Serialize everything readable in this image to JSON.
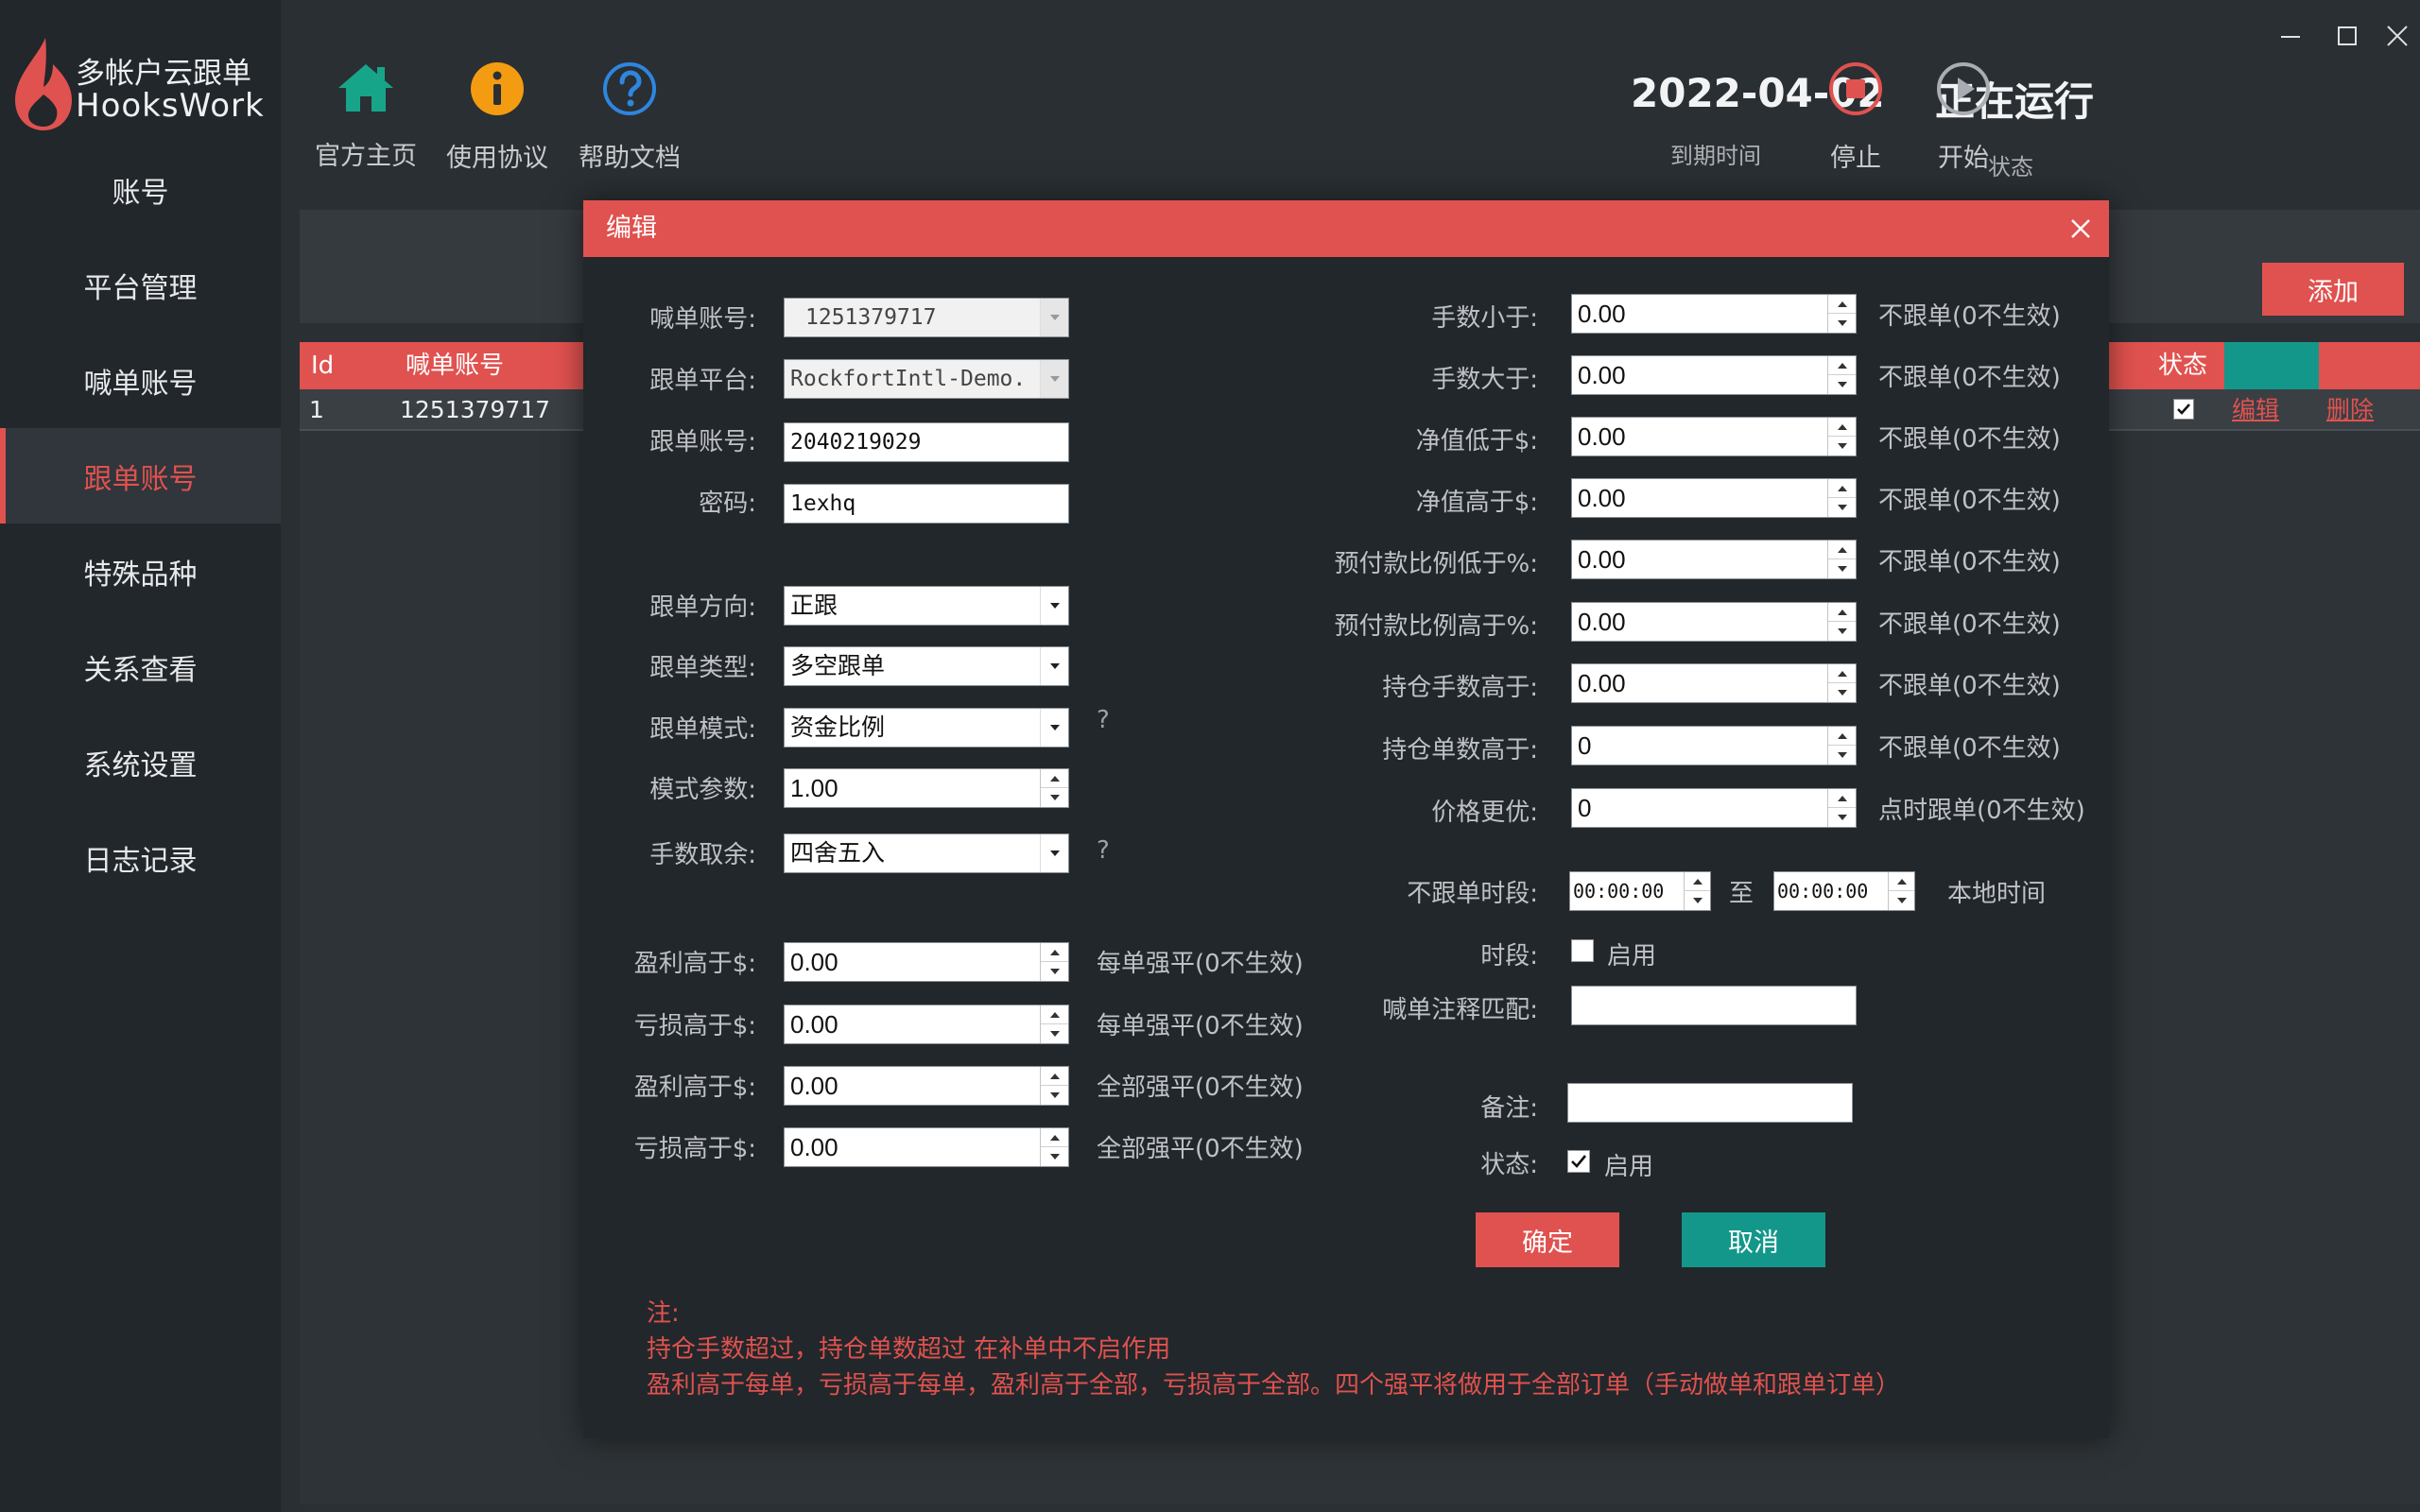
{
  "app": {
    "logo_line1": "多帐户云跟单",
    "logo_line2": "HooksWork"
  },
  "sidebar": {
    "items": [
      {
        "label": "账号"
      },
      {
        "label": "平台管理"
      },
      {
        "label": "喊单账号"
      },
      {
        "label": "跟单账号",
        "active": true
      },
      {
        "label": "特殊品种"
      },
      {
        "label": "关系查看"
      },
      {
        "label": "系统设置"
      },
      {
        "label": "日志记录"
      }
    ]
  },
  "toolbar": {
    "home_label": "官方主页",
    "agreement_label": "使用协议",
    "help_label": "帮助文档"
  },
  "status": {
    "expiry_date": "2022-04-02",
    "expiry_label": "到期时间",
    "state_value": "正在运行",
    "state_label": "状态",
    "stop_label": "停止",
    "start_label": "开始"
  },
  "grid": {
    "add_label": "添加",
    "col_id": "Id",
    "col_caller": "喊单账号",
    "col_status": "状态",
    "row": {
      "id": "1",
      "caller": "1251379717",
      "status_checked": true,
      "edit_label": "编辑",
      "delete_label": "删除"
    }
  },
  "dialog": {
    "title": "编辑",
    "left": {
      "caller_account": {
        "label": "喊单账号:",
        "value": "1251379717"
      },
      "platform": {
        "label": "跟单平台:",
        "value": "RockfortIntl-Demo."
      },
      "follow_account": {
        "label": "跟单账号:",
        "value": "2040219029"
      },
      "password": {
        "label": "密码:",
        "value": "1exhq"
      },
      "direction": {
        "label": "跟单方向:",
        "value": "正跟"
      },
      "type": {
        "label": "跟单类型:",
        "value": "多空跟单"
      },
      "mode": {
        "label": "跟单模式:",
        "value": "资金比例",
        "help": "?"
      },
      "mode_param": {
        "label": "模式参数:",
        "value": "1.00"
      },
      "rounding": {
        "label": "手数取余:",
        "value": "四舍五入",
        "help": "?"
      },
      "profit_each": {
        "label": "盈利高于$:",
        "value": "0.00",
        "note": "每单强平(0不生效)"
      },
      "loss_each": {
        "label": "亏损高于$:",
        "value": "0.00",
        "note": "每单强平(0不生效)"
      },
      "profit_all": {
        "label": "盈利高于$:",
        "value": "0.00",
        "note": "全部强平(0不生效)"
      },
      "loss_all": {
        "label": "亏损高于$:",
        "value": "0.00",
        "note": "全部强平(0不生效)"
      }
    },
    "right": {
      "lots_below": {
        "label": "手数小于:",
        "value": "0.00",
        "note": "不跟单(0不生效)"
      },
      "lots_above": {
        "label": "手数大于:",
        "value": "0.00",
        "note": "不跟单(0不生效)"
      },
      "equity_below": {
        "label": "净值低于$:",
        "value": "0.00",
        "note": "不跟单(0不生效)"
      },
      "equity_above": {
        "label": "净值高于$:",
        "value": "0.00",
        "note": "不跟单(0不生效)"
      },
      "margin_below": {
        "label": "预付款比例低于%:",
        "value": "0.00",
        "note": "不跟单(0不生效)"
      },
      "margin_above": {
        "label": "预付款比例高于%:",
        "value": "0.00",
        "note": "不跟单(0不生效)"
      },
      "pos_lots_above": {
        "label": "持仓手数高于:",
        "value": "0.00",
        "note": "不跟单(0不生效)"
      },
      "pos_count_above": {
        "label": "持仓单数高于:",
        "value": "0",
        "note": "不跟单(0不生效)"
      },
      "price_better": {
        "label": "价格更优:",
        "value": "0",
        "note": "点时跟单(0不生效)"
      },
      "no_follow_period": {
        "label": "不跟单时段:",
        "from": "00:00:00",
        "to_label": "至",
        "to": "00:00:00",
        "note": "本地时间"
      },
      "period_enable": {
        "label": "时段:",
        "checkbox_label": "启用",
        "checked": false
      },
      "comment_match": {
        "label": "喊单注释匹配:",
        "value": ""
      },
      "remark": {
        "label": "备注:",
        "value": ""
      },
      "state": {
        "label": "状态:",
        "checkbox_label": "启用",
        "checked": true
      }
    },
    "ok_label": "确定",
    "cancel_label": "取消",
    "notes": {
      "heading": "注:",
      "line1": "持仓手数超过，持仓单数超过 在补单中不启作用",
      "line2": "盈利高于每单，亏损高于每单，盈利高于全部，亏损高于全部。四个强平将做用于全部订单（手动做单和跟单订单）"
    }
  },
  "colors": {
    "accent_red": "#e0524f",
    "accent_teal": "#13978a",
    "sidebar_bg": "#22272b",
    "main_bg": "#2a2f33"
  }
}
